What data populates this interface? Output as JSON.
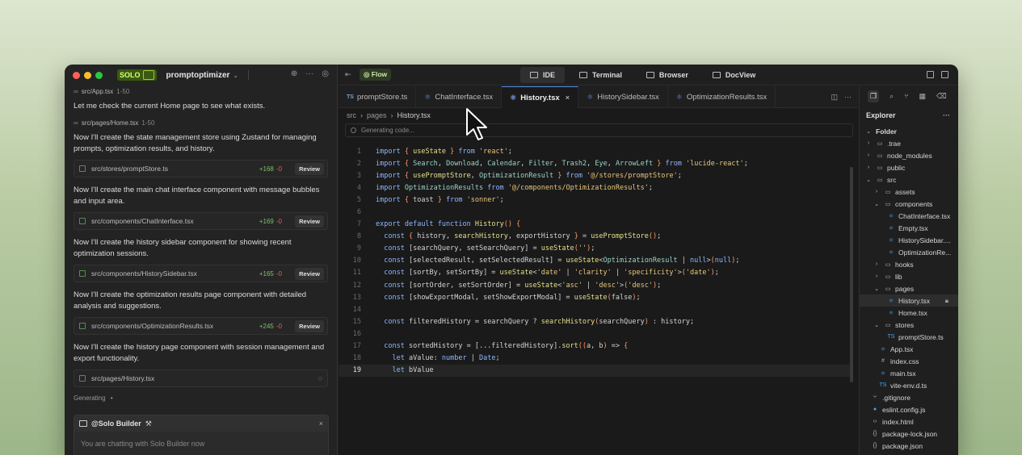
{
  "chat": {
    "badge": "SOLO",
    "project": "promptoptimizer",
    "entries": [
      {
        "type": "ref",
        "path": "src/App.tsx",
        "range": "1-50"
      },
      {
        "type": "msg",
        "text": "Let me check the current Home page to see what exists."
      },
      {
        "type": "ref",
        "path": "src/pages/Home.tsx",
        "range": "1-50"
      },
      {
        "type": "msg",
        "text": "Now I'll create the state management store using Zustand for managing prompts, optimization results, and history."
      },
      {
        "type": "card",
        "path": "src/stores/promptStore.ts",
        "plus": "+168",
        "minus": "-0",
        "action": "Review"
      },
      {
        "type": "msg",
        "text": "Now I'll create the main chat interface component with message bubbles and input area."
      },
      {
        "type": "card",
        "path": "src/components/ChatInterface.tsx",
        "plus": "+169",
        "minus": "-0",
        "action": "Review"
      },
      {
        "type": "msg",
        "text": "Now I'll create the history sidebar component for showing recent optimization sessions."
      },
      {
        "type": "card",
        "path": "src/components/HistorySidebar.tsx",
        "plus": "+165",
        "minus": "-0",
        "action": "Review"
      },
      {
        "type": "msg",
        "text": "Now I'll create the optimization results page component with detailed analysis and suggestions."
      },
      {
        "type": "card",
        "path": "src/components/OptimizationResults.tsx",
        "plus": "+245",
        "minus": "-0",
        "action": "Review"
      },
      {
        "type": "msg",
        "text": "Now I'll create the history page component with session management and export functionality."
      },
      {
        "type": "card",
        "path": "src/pages/History.tsx",
        "loading": true
      }
    ],
    "generating": "Generating",
    "builder_title": "@Solo Builder",
    "builder_placeholder": "You are chatting with Solo Builder now"
  },
  "topbar": {
    "flow": "Flow",
    "modes": [
      "IDE",
      "Terminal",
      "Browser",
      "DocView"
    ]
  },
  "editor": {
    "tabs": [
      {
        "label": "promptStore.ts",
        "kind": "ts"
      },
      {
        "label": "ChatInterface.tsx",
        "kind": "tsx"
      },
      {
        "label": "History.tsx",
        "kind": "tsx",
        "active": true
      },
      {
        "label": "HistorySidebar.tsx",
        "kind": "tsx"
      },
      {
        "label": "OptimizationResults.tsx",
        "kind": "tsx"
      }
    ],
    "breadcrumb": [
      "src",
      "pages",
      "History.tsx"
    ],
    "generating": "Generating code...",
    "current_line": 19,
    "lines": [
      "import { useState } from 'react';",
      "import { Search, Download, Calendar, Filter, Trash2, Eye, ArrowLeft } from 'lucide-react';",
      "import { usePromptStore, OptimizationResult } from '@/stores/promptStore';",
      "import OptimizationResults from '@/components/OptimizationResults';",
      "import { toast } from 'sonner';",
      "",
      "export default function History() {",
      "  const { history, searchHistory, exportHistory } = usePromptStore();",
      "  const [searchQuery, setSearchQuery] = useState('');",
      "  const [selectedResult, setSelectedResult] = useState<OptimizationResult | null>(null);",
      "  const [sortBy, setSortBy] = useState<'date' | 'clarity' | 'specificity'>('date');",
      "  const [sortOrder, setSortOrder] = useState<'asc' | 'desc'>('desc');",
      "  const [showExportModal, setShowExportModal] = useState(false);",
      "",
      "  const filteredHistory = searchQuery ? searchHistory(searchQuery) : history;",
      "",
      "  const sortedHistory = [...filteredHistory].sort((a, b) => {",
      "    let aValue: number | Date;",
      "    let bValue"
    ]
  },
  "explorer": {
    "title": "Explorer",
    "root": "Folder",
    "items": [
      {
        "label": ".trae",
        "depth": 0,
        "kind": "folder",
        "open": false
      },
      {
        "label": "node_modules",
        "depth": 0,
        "kind": "folder",
        "open": false
      },
      {
        "label": "public",
        "depth": 0,
        "kind": "folder",
        "open": false
      },
      {
        "label": "src",
        "depth": 0,
        "kind": "folder",
        "open": true
      },
      {
        "label": "assets",
        "depth": 1,
        "kind": "folder",
        "open": false
      },
      {
        "label": "components",
        "depth": 1,
        "kind": "folder",
        "open": true
      },
      {
        "label": "ChatInterface.tsx",
        "depth": 2,
        "kind": "tsx"
      },
      {
        "label": "Empty.tsx",
        "depth": 2,
        "kind": "tsx"
      },
      {
        "label": "HistorySidebar....",
        "depth": 2,
        "kind": "tsx"
      },
      {
        "label": "OptimizationRe...",
        "depth": 2,
        "kind": "tsx"
      },
      {
        "label": "hooks",
        "depth": 1,
        "kind": "folder",
        "open": false
      },
      {
        "label": "lib",
        "depth": 1,
        "kind": "folder",
        "open": false
      },
      {
        "label": "pages",
        "depth": 1,
        "kind": "folder",
        "open": true
      },
      {
        "label": "History.tsx",
        "depth": 2,
        "kind": "tsx",
        "selected": true,
        "locked": true
      },
      {
        "label": "Home.tsx",
        "depth": 2,
        "kind": "tsx"
      },
      {
        "label": "stores",
        "depth": 1,
        "kind": "folder",
        "open": true
      },
      {
        "label": "promptStore.ts",
        "depth": 2,
        "kind": "ts"
      },
      {
        "label": "App.tsx",
        "depth": 1,
        "kind": "tsx"
      },
      {
        "label": "index.css",
        "depth": 1,
        "kind": "css"
      },
      {
        "label": "main.tsx",
        "depth": 1,
        "kind": "tsx"
      },
      {
        "label": "vite-env.d.ts",
        "depth": 1,
        "kind": "ts"
      },
      {
        "label": ".gitignore",
        "depth": 0,
        "kind": "git"
      },
      {
        "label": "eslint.config.js",
        "depth": 0,
        "kind": "js"
      },
      {
        "label": "index.html",
        "depth": 0,
        "kind": "html"
      },
      {
        "label": "package-lock.json",
        "depth": 0,
        "kind": "json"
      },
      {
        "label": "package.json",
        "depth": 0,
        "kind": "json"
      }
    ]
  }
}
